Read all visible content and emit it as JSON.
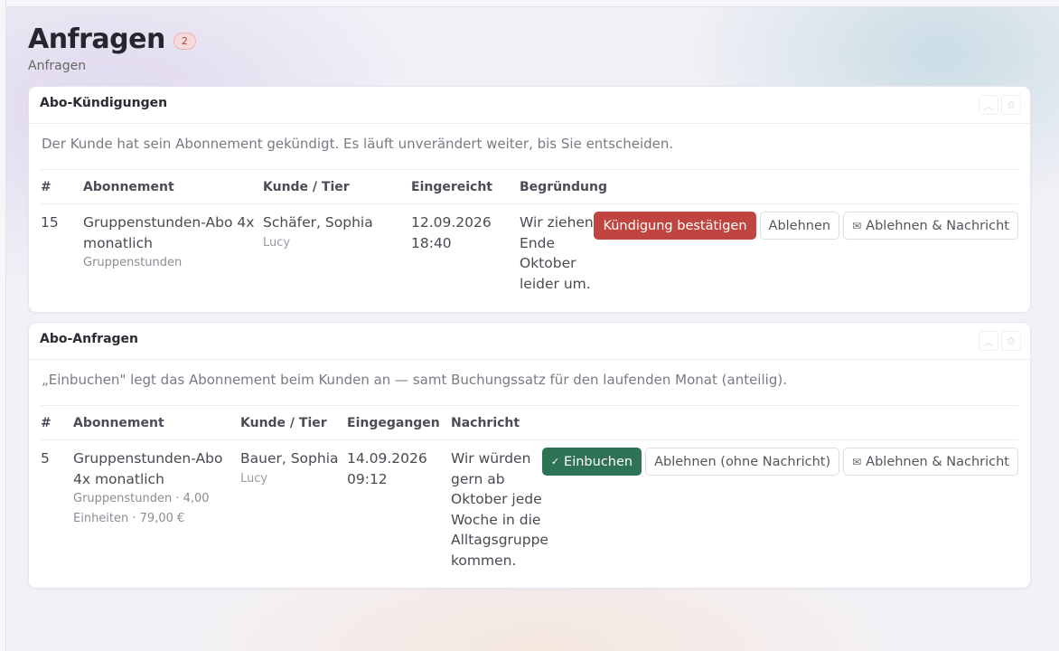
{
  "page": {
    "title": "Anfragen",
    "count": "2",
    "subtitle": "Anfragen"
  },
  "cancellations": {
    "title": "Abo-Kündigungen",
    "note": "Der Kunde hat sein Abonnement gekündigt. Es läuft unverändert weiter, bis Sie entscheiden.",
    "columns": [
      "#",
      "Abonnement",
      "Kunde / Tier",
      "Eingereicht",
      "Begründung"
    ],
    "rows": [
      {
        "id": "15",
        "subscription_line1": "Gruppenstunden-Abo 4x",
        "subscription_line2": "monatlich",
        "subscription_sub": "Gruppenstunden",
        "customer": "Schäfer, Sophia",
        "tier": "Lucy",
        "date": "12.09.2026",
        "time": "18:40",
        "reason": [
          "Wir ziehen",
          "Ende",
          "Oktober",
          "leider um."
        ],
        "actions": {
          "confirm": "Kündigung bestätigen",
          "reject": "Ablehnen",
          "reject_message": "Ablehnen & Nachricht"
        }
      }
    ]
  },
  "requests": {
    "title": "Abo-Anfragen",
    "note": "„Einbuchen\" legt das Abonnement beim Kunden an — samt Buchungssatz für den laufenden Monat (anteilig).",
    "columns": [
      "#",
      "Abonnement",
      "Kunde / Tier",
      "Eingegangen",
      "Nachricht"
    ],
    "rows": [
      {
        "id": "5",
        "subscription_line1": "Gruppenstunden-Abo",
        "subscription_line2": "4x monatlich",
        "subscription_sub1": "Gruppenstunden · 4,00",
        "subscription_sub2": "Einheiten · 79,00 €",
        "customer": "Bauer, Sophia",
        "tier": "Lucy",
        "date": "14.09.2026",
        "time": "09:12",
        "message": [
          "Wir würden",
          "gern ab",
          "Oktober jede",
          "Woche in die",
          "Alltagsgruppe",
          "kommen."
        ],
        "actions": {
          "book": "Einbuchen",
          "reject_silent": "Ablehnen (ohne Nachricht)",
          "reject_message": "Ablehnen & Nachricht"
        }
      }
    ]
  },
  "icons": {
    "collapse": "chevron-up-icon",
    "print": "print-icon",
    "mail": "mail-x-icon",
    "check": "check-icon"
  },
  "colors": {
    "danger": "#c0443f",
    "success": "#2e7356",
    "badge_bg": "#f6d9da",
    "badge_text": "#b0444a"
  }
}
